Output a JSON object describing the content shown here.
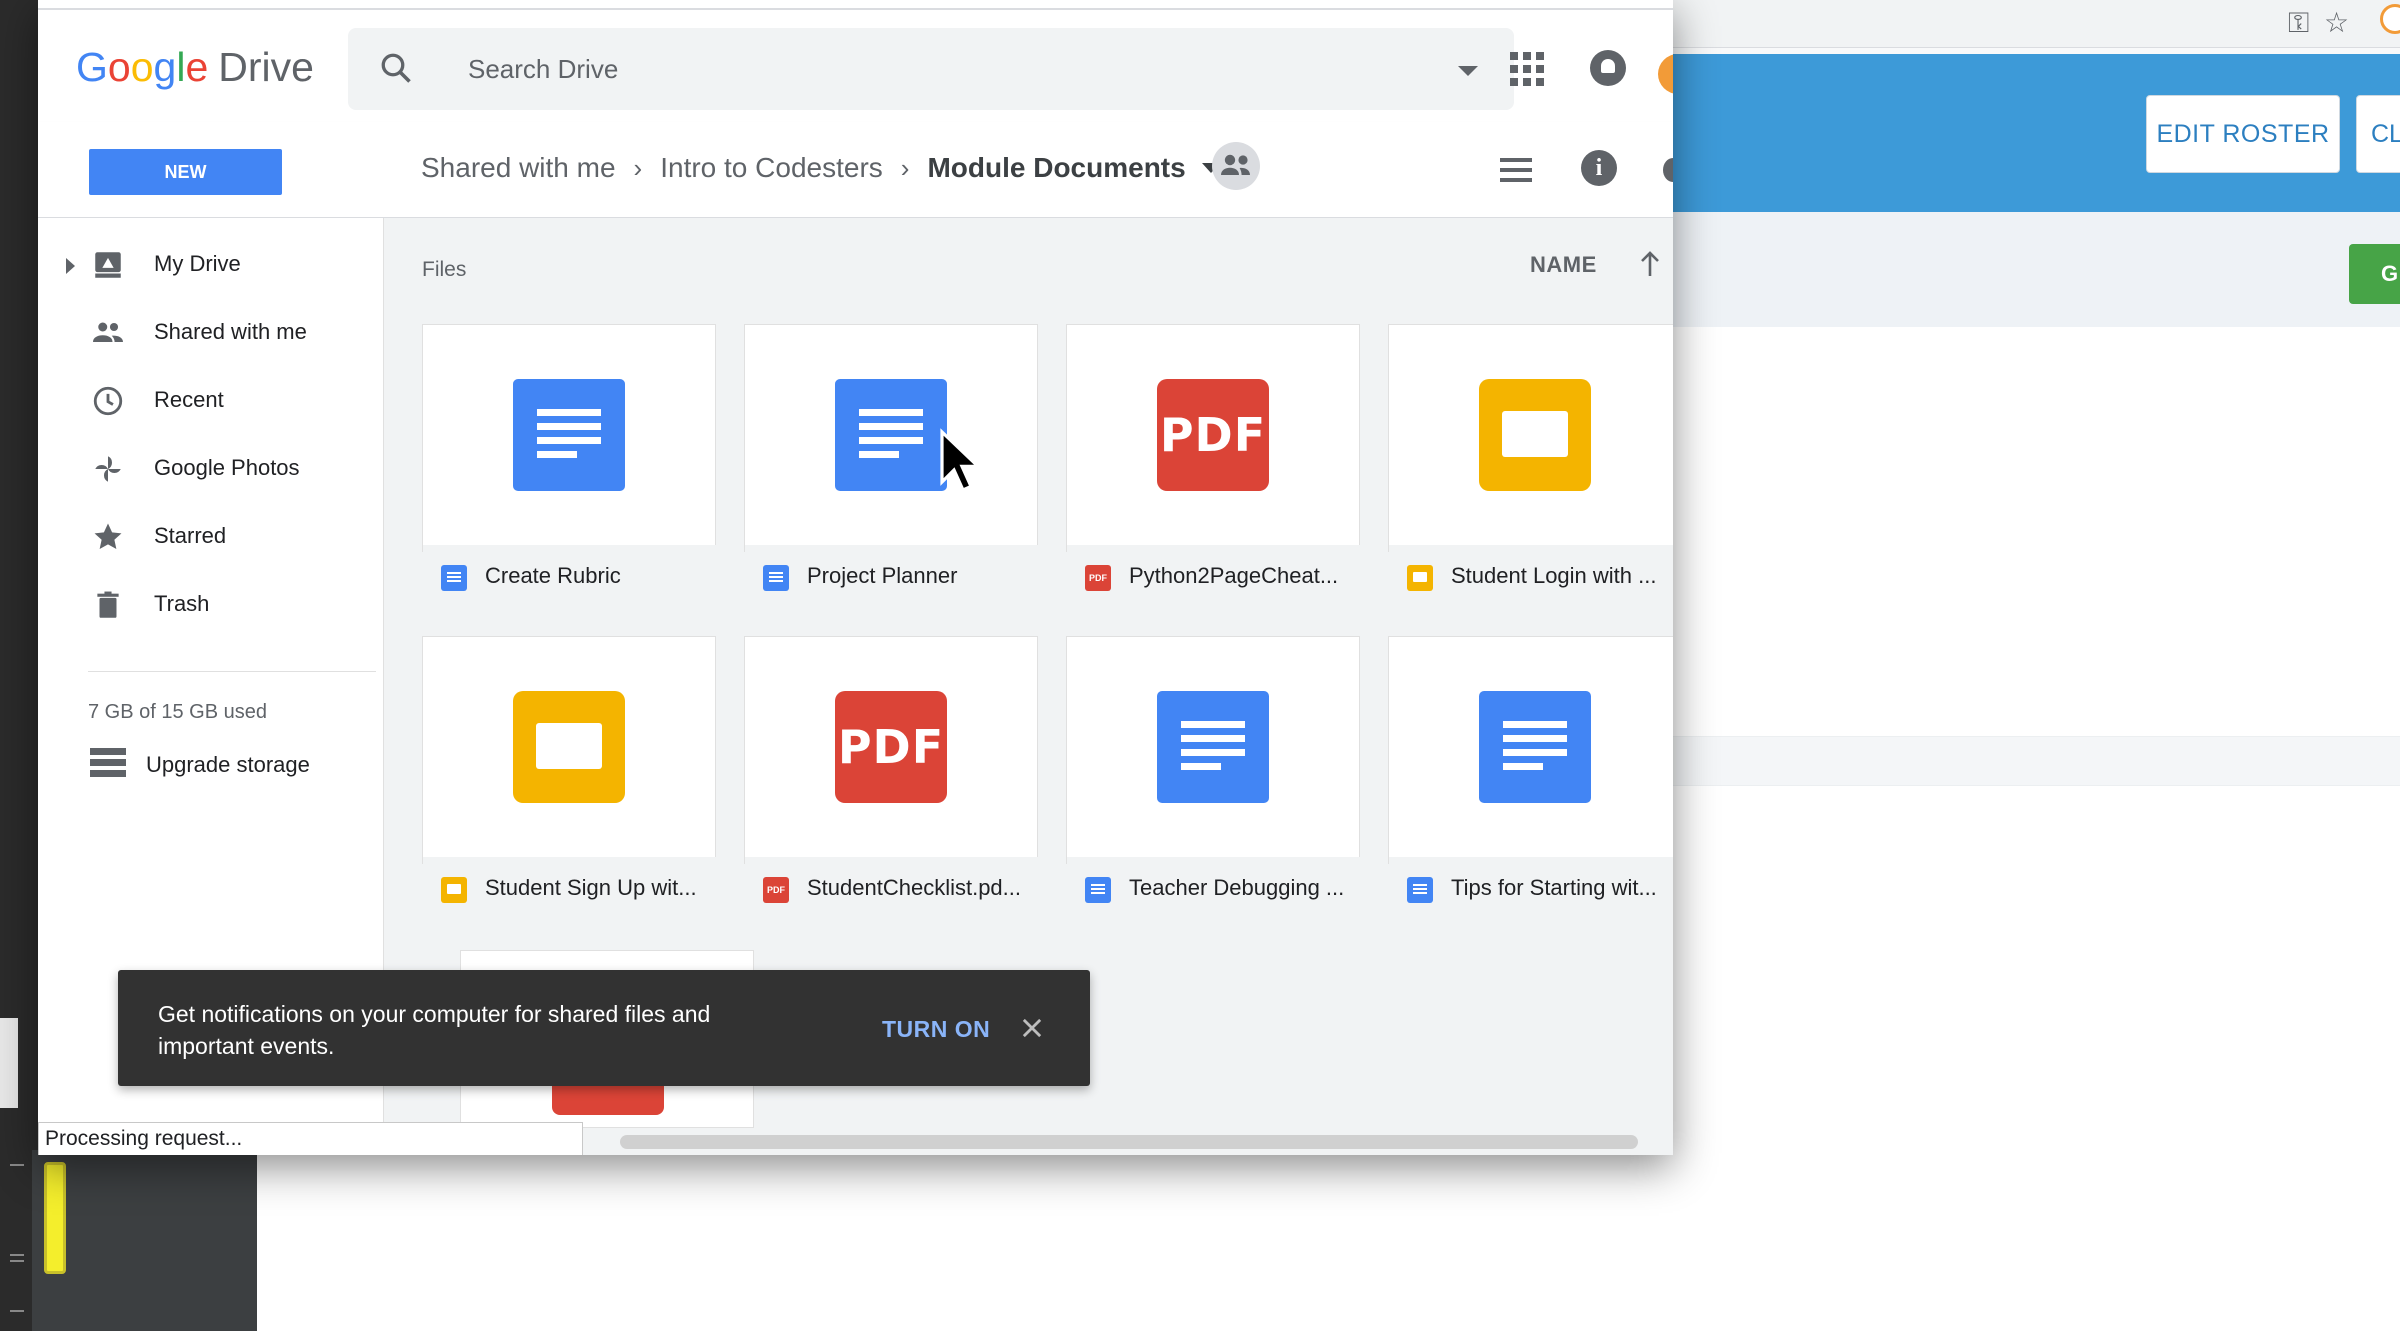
{
  "browser": {
    "icons": [
      "key-icon",
      "star-icon"
    ]
  },
  "background_app": {
    "edit_roster_label": "EDIT ROSTER",
    "cl_button_label": "CL",
    "green_button_label": "G",
    "banner_color": "#3d9ad8"
  },
  "drive": {
    "logo_letters": [
      "G",
      "o",
      "o",
      "g",
      "l",
      "e"
    ],
    "logo_product": "Drive",
    "search": {
      "placeholder": "Search Drive"
    },
    "new_button": "NEW",
    "breadcrumb": {
      "items": [
        "Shared with me",
        "Intro to Codesters"
      ],
      "current": "Module Documents"
    },
    "sidebar": {
      "items": [
        {
          "label": "My Drive",
          "icon": "my-drive-icon"
        },
        {
          "label": "Shared with me",
          "icon": "shared-with-me-icon"
        },
        {
          "label": "Recent",
          "icon": "clock-icon"
        },
        {
          "label": "Google Photos",
          "icon": "pinwheel-icon"
        },
        {
          "label": "Starred",
          "icon": "star-icon"
        },
        {
          "label": "Trash",
          "icon": "trash-icon"
        }
      ],
      "storage": "7 GB of 15 GB used",
      "upgrade": "Upgrade storage"
    },
    "main": {
      "section_label": "Files",
      "sort_label": "NAME",
      "files": [
        {
          "name": "Create Rubric",
          "type": "doc"
        },
        {
          "name": "Project Planner",
          "type": "doc"
        },
        {
          "name": "Python2PageCheat...",
          "type": "pdf"
        },
        {
          "name": "Student Login with ...",
          "type": "slides"
        },
        {
          "name": "Student Sign Up wit...",
          "type": "slides"
        },
        {
          "name": "StudentChecklist.pd...",
          "type": "pdf"
        },
        {
          "name": "Teacher Debugging ...",
          "type": "doc"
        },
        {
          "name": "Tips for Starting wit...",
          "type": "doc"
        }
      ]
    },
    "toast": {
      "message": "Get notifications on your computer for shared files and important events.",
      "action": "TURN ON"
    },
    "status_bar": "Processing request..."
  },
  "colors": {
    "doc": "#4285f4",
    "pdf": "#db4437",
    "slides": "#f4b400",
    "new_button": "#4285f4"
  }
}
